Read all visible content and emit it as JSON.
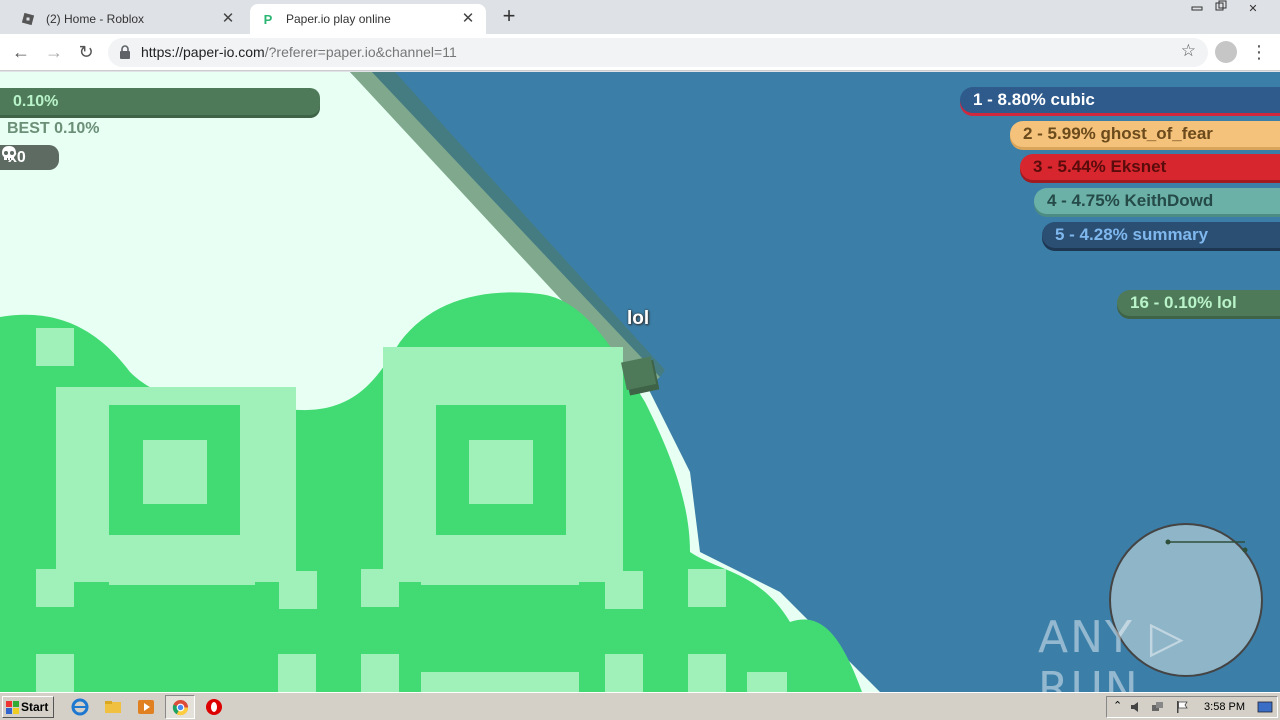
{
  "browser": {
    "tabs": [
      {
        "title": "(2) Home - Roblox",
        "active": false
      },
      {
        "title": "Paper.io play online",
        "active": true
      }
    ],
    "url_main": "https://paper-io.com",
    "url_rest": "/?referer=paper.io&channel=11"
  },
  "hud": {
    "percent": "0.10%",
    "best": "BEST 0.10%",
    "kills": "x0"
  },
  "leaderboard": [
    {
      "text": "1 - 8.80% cubic",
      "bg": "#2e5a8c",
      "fg": "#ffffff",
      "shadow": "#d0283c"
    },
    {
      "text": "2 - 5.99% ghost_of_fear",
      "bg": "#f4c27a",
      "fg": "#6b4a1c",
      "shadow": "#d9a55a"
    },
    {
      "text": "3 - 5.44% Eksnet",
      "bg": "#d8262e",
      "fg": "#5a0c0c",
      "shadow": "#a01a20"
    },
    {
      "text": "4 - 4.75% KeithDowd",
      "bg": "#6bb1a8",
      "fg": "#254a47",
      "shadow": "#4d8c84"
    },
    {
      "text": "5 - 4.28% summary",
      "bg": "#2b4e73",
      "fg": "#7fb8ee",
      "shadow": "#1d3651"
    },
    {
      "text": "16 - 0.10% lol",
      "bg": "#4f7a59",
      "fg": "#b9f3c9",
      "shadow": "#3e6347"
    }
  ],
  "player": {
    "name": "lol"
  },
  "watermark": "ANY RUN",
  "taskbar": {
    "start_label": "Start",
    "clock": "3:58 PM"
  },
  "colors": {
    "ocean": "#3b7fa8",
    "territory": "#42db73",
    "territory_light": "#9ff0b9",
    "trail": "#e8fff3",
    "player": "#4f7a59"
  }
}
